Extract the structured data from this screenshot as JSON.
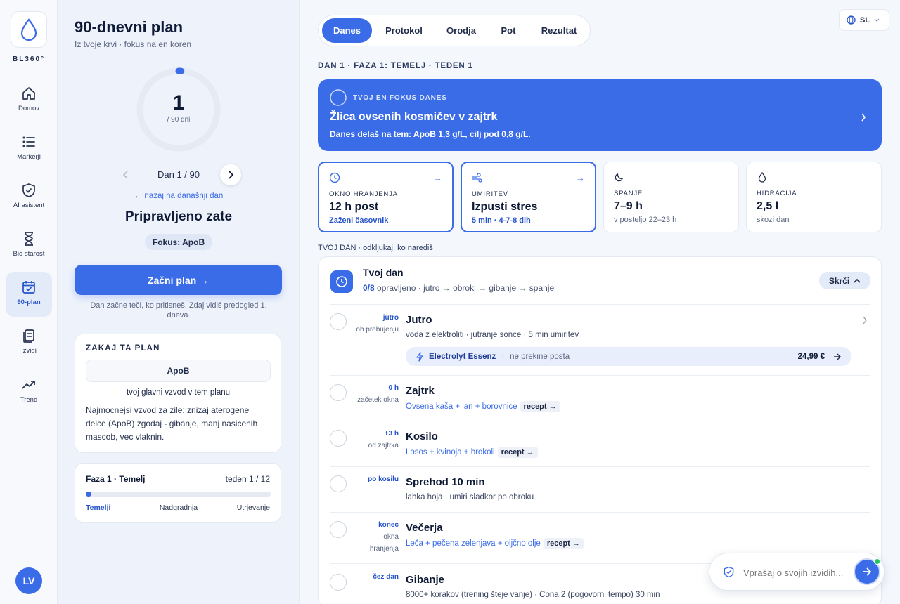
{
  "app": {
    "brand": "BL360°",
    "avatar": "LV"
  },
  "nav": [
    {
      "label": "Domov",
      "icon": "home-icon"
    },
    {
      "label": "Markerji",
      "icon": "list-icon"
    },
    {
      "label": "AI asistent",
      "icon": "shield-icon"
    },
    {
      "label": "Bio starost",
      "icon": "hourglass-icon"
    },
    {
      "label": "90-plan",
      "icon": "calendar-icon",
      "active": true
    },
    {
      "label": "Izvidi",
      "icon": "documents-icon"
    },
    {
      "label": "Trend",
      "icon": "trend-icon"
    }
  ],
  "plan": {
    "title": "90-dnevni plan",
    "subtitle": "Iz tvoje krvi · fokus na en koren",
    "day_number": "1",
    "day_total": "/ 90 dni",
    "progress_fraction": 0.011,
    "day_nav": "Dan 1 / 90",
    "back_link": "← nazaj na današnji dan",
    "ready": "Pripravljeno zate",
    "focus_pill": "Fokus: ApoB",
    "start_button": "Začni plan →",
    "start_note": "Dan začne teči, ko pritisneš. Zdaj vidiš predogled 1. dneva."
  },
  "why": {
    "title": "ZAKAJ TA PLAN",
    "marker": "ApoB",
    "caption": "tvoj glavni vzvod v tem planu",
    "body": "Najmocnejsi vzvod za zile: znizaj aterogene delce (ApoB) zgodaj - gibanje, manj nasicenih mascob, vec vlaknin."
  },
  "phase": {
    "title": "Faza 1 · Temelj",
    "week": "teden 1 / 12",
    "progress_fraction": 0.03,
    "stages": [
      "Temelji",
      "Nadgradnja",
      "Utrjevanje"
    ]
  },
  "tabs": [
    "Danes",
    "Protokol",
    "Orodja",
    "Pot",
    "Rezultat"
  ],
  "active_tab": "Danes",
  "lang": "SL",
  "breadcrumb": "DAN 1 · FAZA 1: TEMELJ · TEDEN 1",
  "hero": {
    "label": "TVOJ EN FOKUS DANES",
    "title": "Žlica ovsenih kosmičev v zajtrk",
    "text": "Danes delaš na tem: ApoB 1,3 g/L, cilj pod 0,8 g/L."
  },
  "tiles": [
    {
      "label": "OKNO HRANJENJA",
      "value": "12 h post",
      "sub": "Zaženi časovnik",
      "icon": "clock-icon"
    },
    {
      "label": "UMIRITEV",
      "value": "Izpusti stres",
      "sub": "5 min · 4-7-8 dih",
      "icon": "wind-icon"
    },
    {
      "label": "SPANJE",
      "value": "7–9 h",
      "sub": "v posteljo 22–23 h",
      "icon": "moon-icon"
    },
    {
      "label": "HIDRACIJA",
      "value": "2,5 l",
      "sub": "skozi dan",
      "icon": "drop-icon"
    }
  ],
  "day_section": "TVOJ DAN · odkljukaj, ko narediš",
  "day": {
    "title": "Tvoj dan",
    "done": "0/8",
    "summary": "opravljeno · jutro → obroki → gibanje → spanje",
    "hide_label": "Skrči",
    "items": [
      {
        "time_a": "jutro",
        "time_b": "ob prebujenju",
        "time_c": "",
        "title": "Jutro",
        "desc": "voda z elektroliti · jutranje sonce · 5 min umiritev",
        "recept": ""
      },
      {
        "time_a": "0 h",
        "time_b": "začetek okna",
        "time_c": "",
        "title": "Zajtrk",
        "desc": "Ovsena kaša + lan + borovnice",
        "recept": "recept →"
      },
      {
        "time_a": "+3 h",
        "time_b": "od zajtrka",
        "time_c": "",
        "title": "Kosilo",
        "desc": "Losos + kvinoja + brokoli",
        "recept": "recept →"
      },
      {
        "time_a": "po kosilu",
        "time_b": "",
        "time_c": "",
        "title": "Sprehod 10 min",
        "desc": "lahka hoja · umiri sladkor po obroku",
        "recept": ""
      },
      {
        "time_a": "konec",
        "time_b": "okna",
        "time_c": "hranjenja",
        "title": "Večerja",
        "desc": "Leča + pečena zelenjava + oljčno olje",
        "recept": "recept →"
      },
      {
        "time_a": "čez dan",
        "time_b": "",
        "time_c": "",
        "title": "Gibanje",
        "desc": "8000+ korakov (trening šteje vanje) · Cona 2 (pogovorni tempo) 30 min",
        "recept": ""
      }
    ],
    "product": {
      "name": "Electrolyt Essenz",
      "note": "ne prekine posta",
      "price": "24,99 €"
    }
  },
  "ask": {
    "placeholder": "Vprašaj o svojih izvidih..."
  },
  "colors": {
    "accent": "#3b6ce7",
    "ink": "#0f1b36",
    "online": "#22c55e"
  }
}
